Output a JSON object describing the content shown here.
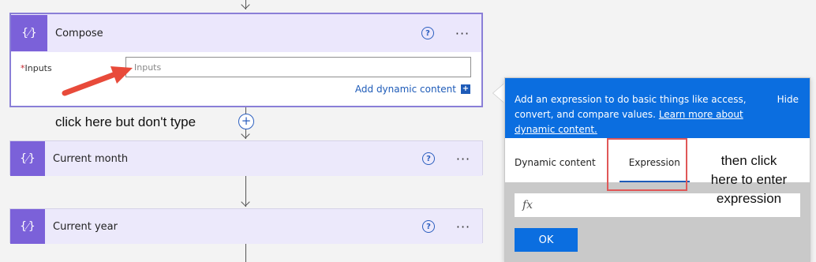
{
  "flow": {
    "compose": {
      "title": "Compose",
      "inputs_label": "Inputs",
      "inputs_placeholder": "Inputs",
      "add_dynamic_content": "Add dynamic content",
      "add_dynamic_icon": "+"
    },
    "current_month": {
      "title": "Current month"
    },
    "current_year": {
      "title": "Current year"
    },
    "help_glyph": "?",
    "more_glyph": "···",
    "card_icon_glyph": "{⁄}",
    "insert_step_glyph": "+"
  },
  "annotations": {
    "click_note": "click  here but don't type",
    "expr_note_line1": "then click",
    "expr_note_line2": "here to enter",
    "expr_note_line3": "expression"
  },
  "panel": {
    "description": "Add an expression to do basic things like access, convert, and compare values.",
    "learn_more": "Learn more about dynamic content.",
    "hide": "Hide",
    "tabs": [
      {
        "label": "Dynamic content",
        "active": false
      },
      {
        "label": "Expression",
        "active": true
      }
    ],
    "fx_symbol": "fx",
    "ok_label": "OK"
  },
  "colors": {
    "accent": "#7b61d9",
    "panel_blue": "#0b6ee0",
    "link_blue": "#1e5bb8",
    "annotation_red": "#e05858"
  },
  "icons": [
    "card-brace-icon",
    "help-icon",
    "more-icon",
    "add-icon",
    "fx-icon",
    "arrow-down-icon"
  ]
}
